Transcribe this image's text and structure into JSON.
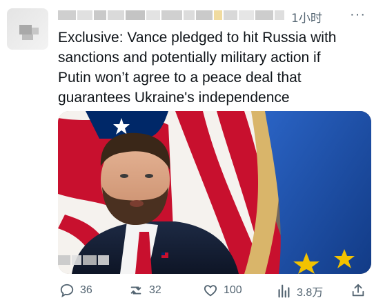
{
  "post": {
    "time": "1小时",
    "more_icon": "more-dots-icon",
    "text_lines": [
      "Exclusive: Vance pledged to hit Russia with",
      "sanctions and potentially military action if",
      "Putin won’t agree to a peace deal that",
      "guarantees Ukraine's independence"
    ]
  },
  "actions": {
    "reply": {
      "icon": "comment-icon",
      "count": "36"
    },
    "retweet": {
      "icon": "retweet-icon",
      "count": "32"
    },
    "like": {
      "icon": "heart-icon",
      "count": "100"
    },
    "views": {
      "icon": "bar-chart-icon",
      "count": "3.8万"
    },
    "share": {
      "icon": "share-icon"
    }
  },
  "colors": {
    "text": "#0f1419",
    "muted": "#536471",
    "flag_red": "#c8102e",
    "flag_blue": "#002868",
    "eu_blue": "#1c4fa8",
    "eu_gold": "#f2c200"
  }
}
